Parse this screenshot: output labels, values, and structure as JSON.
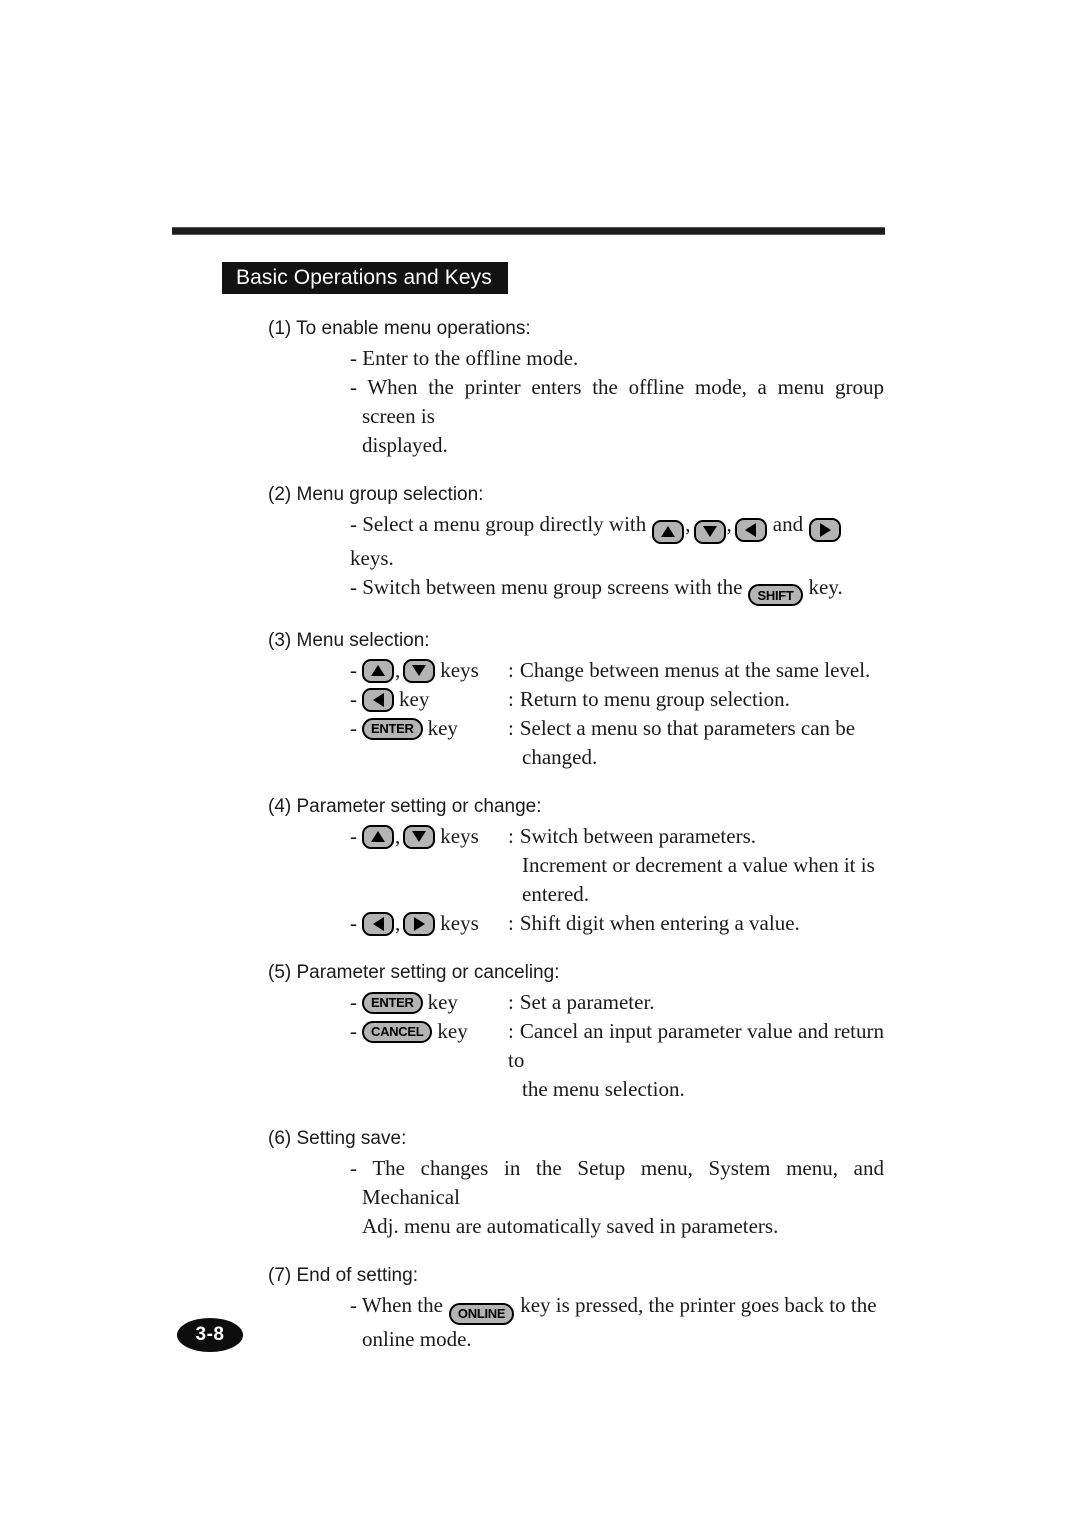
{
  "document": {
    "section_title": "Basic Operations and Keys",
    "page_number": "3-8"
  },
  "keys": {
    "up": "up-arrow-key",
    "down": "down-arrow-key",
    "left": "left-arrow-key",
    "right": "right-arrow-key",
    "shift": "SHIFT",
    "enter": "ENTER",
    "cancel": "CANCEL",
    "online": "ONLINE"
  },
  "sections": [
    {
      "number": "(1)",
      "heading": "(1) To enable menu operations:",
      "lines": [
        "- Enter to the offline mode.",
        "- When the printer enters the offline mode, a menu group screen is",
        "displayed."
      ]
    },
    {
      "number": "(2)",
      "heading": "(2) Menu group selection:",
      "line1_pre": "- Select a menu group directly with",
      "line1_mid": "and",
      "line1_post": "keys.",
      "line2_pre": "- Switch between menu group screens with the",
      "line2_post": "key."
    },
    {
      "number": "(3)",
      "heading": "(3) Menu selection:",
      "rows": [
        {
          "dash": "-",
          "label": "keys",
          "colon": ":",
          "desc": "Change between menus at the same level."
        },
        {
          "dash": "-",
          "label": "key",
          "colon": ":",
          "desc": "Return to menu group selection."
        },
        {
          "dash": "-",
          "label": "key",
          "colon": ":",
          "desc": "Select a menu so that parameters can be",
          "desc2": "changed."
        }
      ]
    },
    {
      "number": "(4)",
      "heading": "(4) Parameter setting or change:",
      "rows": [
        {
          "dash": "-",
          "label": "keys",
          "colon": ":",
          "desc": "Switch between parameters."
        },
        {
          "cont1": "Increment or decrement a value when it is",
          "cont2": "entered."
        },
        {
          "dash": "-",
          "label": "keys",
          "colon": ":",
          "desc": "Shift digit when entering a value."
        }
      ]
    },
    {
      "number": "(5)",
      "heading": "(5) Parameter setting or canceling:",
      "rows": [
        {
          "dash": "-",
          "label": "key",
          "colon": ":",
          "desc": "Set a parameter."
        },
        {
          "dash": "-",
          "label": "key",
          "colon": ":",
          "desc": "Cancel an input parameter value and return to",
          "desc2": "the menu selection."
        }
      ]
    },
    {
      "number": "(6)",
      "heading": "(6) Setting save:",
      "lines": [
        "- The changes in the Setup menu, System menu, and Mechanical",
        "Adj. menu are automatically saved in parameters."
      ]
    },
    {
      "number": "(7)",
      "heading": "(7) End of setting:",
      "line1_pre": "- When the",
      "line1_post": "key is pressed, the printer goes back to the",
      "line2": "online mode."
    }
  ]
}
